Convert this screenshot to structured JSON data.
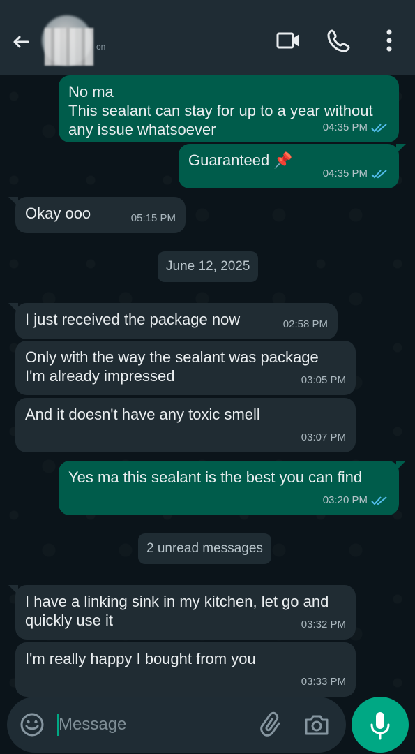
{
  "header": {
    "subtitle": "on",
    "icons": [
      "back-arrow-icon",
      "video-call-icon",
      "voice-call-icon",
      "more-options-icon"
    ]
  },
  "messages": [
    {
      "direction": "out",
      "text": "No ma\nThis sealant can stay for up to a year without\nany issue whatsoever",
      "time": "04:35 PM",
      "status": "read"
    },
    {
      "direction": "out",
      "text": "Guaranteed 📌",
      "time": "04:35 PM",
      "status": "read"
    },
    {
      "direction": "in",
      "text": "Okay ooo",
      "time": "05:15 PM"
    },
    {
      "direction": "in",
      "text": "I just received the package now",
      "time": "02:58 PM"
    },
    {
      "direction": "in",
      "text": "Only with the way the sealant was package\nI'm already impressed",
      "time": "03:05 PM"
    },
    {
      "direction": "in",
      "text": "And it doesn't have any toxic smell",
      "time": "03:07 PM"
    },
    {
      "direction": "out",
      "text": "Yes ma this sealant is the best you can find",
      "time": "03:20 PM",
      "status": "read"
    },
    {
      "direction": "in",
      "text": "I have a linking sink in my kitchen, let go and\nquickly use it",
      "time": "03:32 PM"
    },
    {
      "direction": "in",
      "text": "I'm really happy I bought from you",
      "time": "03:33 PM"
    }
  ],
  "chips": {
    "date": "June 12, 2025",
    "unread": "2 unread messages"
  },
  "input": {
    "placeholder": "Message"
  },
  "colors": {
    "background": "#0b141a",
    "header": "#1f2c34",
    "outgoing_bubble": "#005c4b",
    "incoming_bubble": "#202c33",
    "read_ticks": "#53bdeb",
    "accent": "#00a884"
  }
}
